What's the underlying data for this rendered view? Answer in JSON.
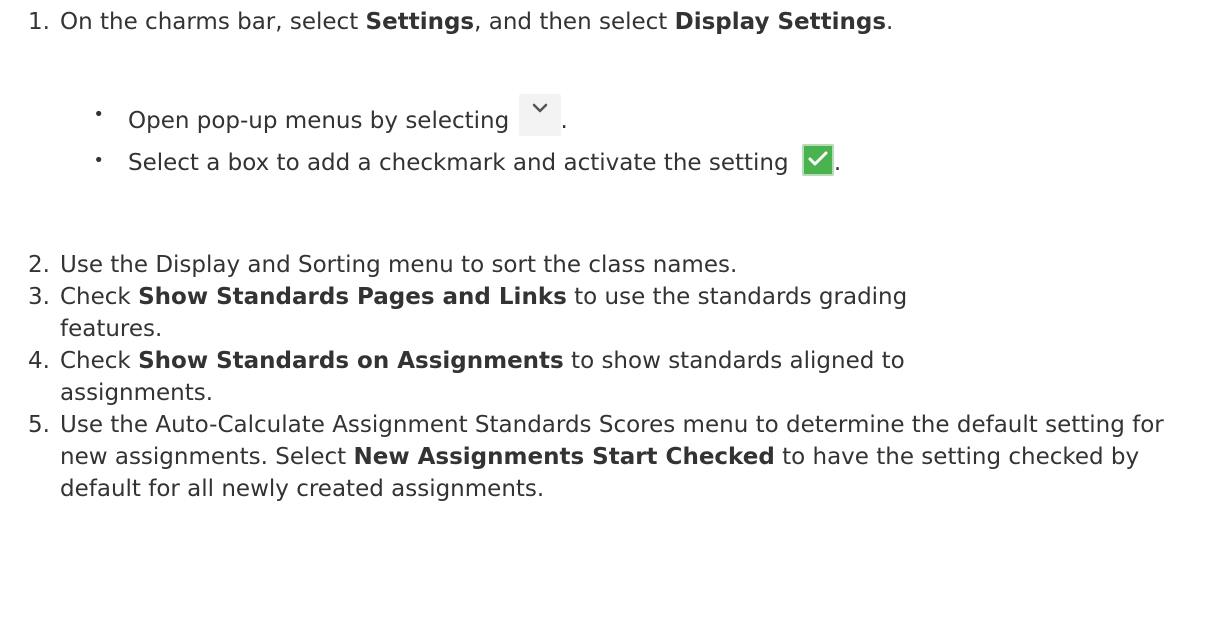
{
  "steps": [
    {
      "number": "1.",
      "parts": [
        {
          "text": "On the charms bar, select ",
          "bold": false
        },
        {
          "text": "Settings",
          "bold": true
        },
        {
          "text": ", and then select ",
          "bold": false
        },
        {
          "text": "Display Settings",
          "bold": true
        },
        {
          "text": ".",
          "bold": false
        }
      ]
    },
    {
      "number": "2.",
      "parts": [
        {
          "text": "Use the Display and Sorting menu to sort the class names.",
          "bold": false
        }
      ]
    },
    {
      "number": "3.",
      "parts": [
        {
          "text": "Check ",
          "bold": false
        },
        {
          "text": "Show Standards Pages and Links",
          "bold": true
        },
        {
          "text": " to use the standards grading features.",
          "bold": false
        }
      ]
    },
    {
      "number": "4.",
      "parts": [
        {
          "text": "Check ",
          "bold": false
        },
        {
          "text": "Show Standards on Assignments",
          "bold": true
        },
        {
          "text": " to show standards aligned to assignments.",
          "bold": false
        }
      ]
    },
    {
      "number": "5.",
      "parts": [
        {
          "text": "Use the Auto-Calculate Assignment Standards Scores menu to determine the default setting for new assignments. Select ",
          "bold": false
        },
        {
          "text": "New Assignments Start Checked",
          "bold": true
        },
        {
          "text": " to have the setting checked by default for all newly created assignments.",
          "bold": false
        }
      ]
    }
  ],
  "bullets": [
    {
      "text_before": "Open pop-up menus by selecting ",
      "icon": "chevron-down-icon",
      "text_after": "."
    },
    {
      "text_before": "Select a box to add a checkmark and activate the setting ",
      "icon": "checkbox-checked-icon",
      "text_after": "."
    }
  ],
  "colors": {
    "text": "#333333",
    "icon_button_bg": "#f3f3f3",
    "checkbox_green": "#4ab24f"
  }
}
